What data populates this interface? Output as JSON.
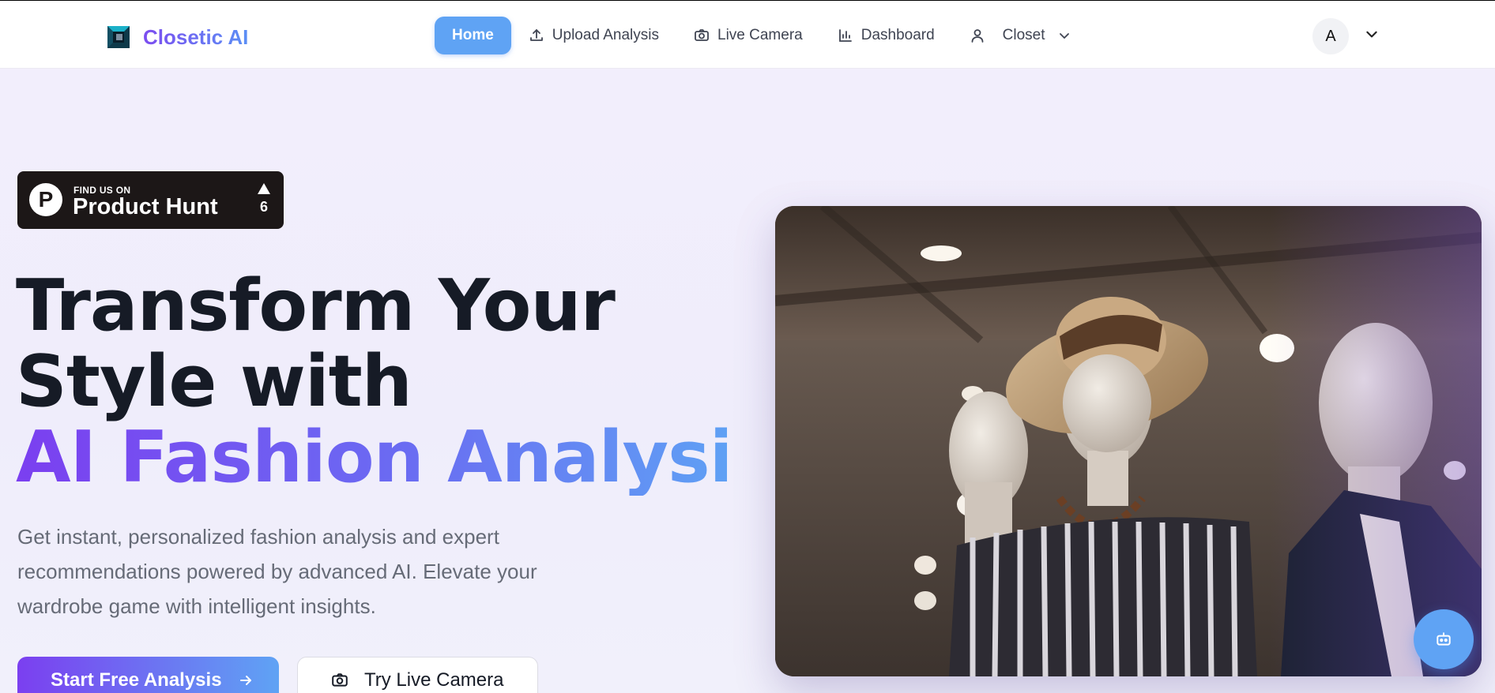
{
  "brand": {
    "name": "Closetic AI",
    "logo_icon": "closetic-logo-icon"
  },
  "nav": {
    "home": "Home",
    "upload": "Upload Analysis",
    "camera": "Live Camera",
    "dashboard": "Dashboard",
    "closet": "Closet"
  },
  "user": {
    "initial": "A"
  },
  "product_hunt": {
    "small": "FIND US ON",
    "big": "Product Hunt",
    "letter": "P",
    "upvotes": "6"
  },
  "hero": {
    "line1": "Transform Your",
    "line2": "Style with",
    "line3": "AI Fashion Analysis",
    "subtitle": "Get instant, personalized fashion analysis and expert recommendations powered by advanced AI. Elevate your wardrobe game with intelligent insights.",
    "primary_cta": "Start Free Analysis",
    "secondary_cta": "Try Live Camera"
  },
  "colors": {
    "accent_purple": "#7b3ff0",
    "accent_blue": "#5fa3f4",
    "text_dark": "#161b26",
    "text_muted": "#666b77"
  }
}
